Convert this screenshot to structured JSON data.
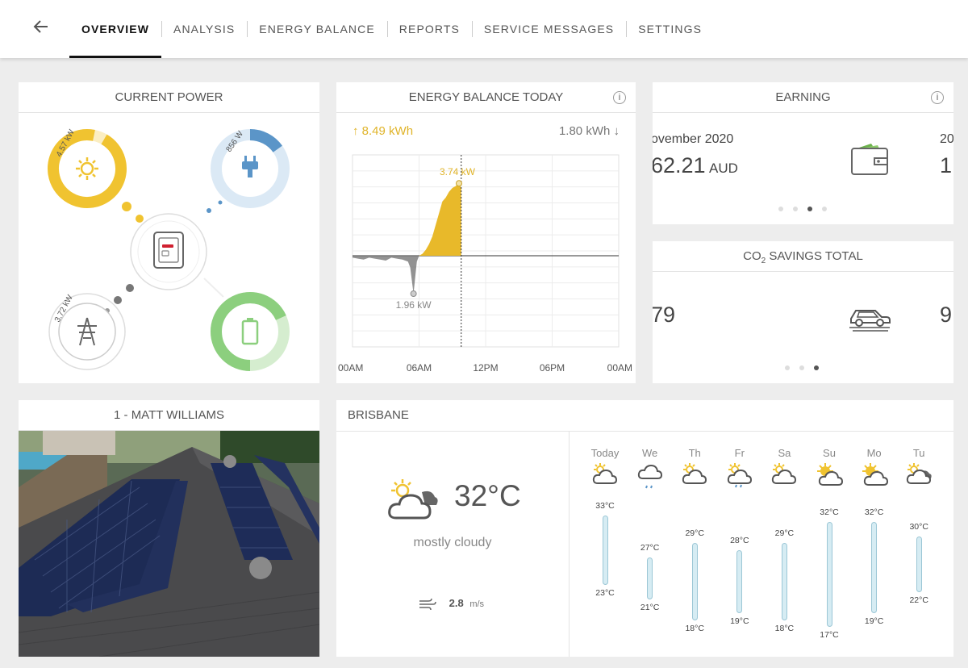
{
  "nav": {
    "back_label": "←",
    "tabs": [
      {
        "label": "OVERVIEW",
        "active": true
      },
      {
        "label": "ANALYSIS"
      },
      {
        "label": "ENERGY BALANCE"
      },
      {
        "label": "REPORTS"
      },
      {
        "label": "SERVICE MESSAGES"
      },
      {
        "label": "SETTINGS"
      }
    ]
  },
  "current_power": {
    "title": "CURRENT POWER",
    "solar": {
      "value": "4.57 kW",
      "icon": "sun-icon",
      "color": "#f0c330",
      "fraction": 0.95
    },
    "consumption": {
      "value": "856 W",
      "icon": "plug-icon",
      "color": "#5b95c8",
      "fraction": 0.2
    },
    "grid": {
      "value": "3.72 kW",
      "icon": "pylon-icon"
    },
    "battery": {
      "icon": "battery-icon",
      "color": "#8ccf7e"
    },
    "inverter": {
      "icon": "inverter-icon"
    }
  },
  "energy_balance": {
    "title": "ENERGY BALANCE TODAY",
    "produced": "8.49 kWh",
    "consumed": "1.80 kWh",
    "peak_label": "3.74 kW",
    "low_label": "1.96 kW",
    "x_ticks": [
      "00AM",
      "06AM",
      "12PM",
      "06PM",
      "00AM"
    ]
  },
  "chart_data": {
    "type": "area",
    "title": "ENERGY BALANCE TODAY",
    "x_ticks": [
      "00AM",
      "06AM",
      "12PM",
      "06PM",
      "00AM"
    ],
    "x_hours": [
      0,
      0.5,
      1,
      1.5,
      2,
      2.5,
      3,
      3.5,
      4,
      4.5,
      5,
      5.2,
      5.5,
      5.8,
      6,
      6.3,
      6.6,
      6.9,
      7.2,
      7.5,
      7.8,
      8.1,
      8.4,
      8.7,
      9,
      9.3,
      9.6,
      9.8
    ],
    "values_kw": [
      -0.1,
      -0.15,
      -0.2,
      -0.1,
      -0.15,
      -0.2,
      -0.25,
      -0.1,
      -0.15,
      -0.2,
      -0.3,
      -0.6,
      -1.96,
      -0.3,
      0.0,
      0.1,
      0.3,
      0.6,
      1.0,
      1.6,
      2.2,
      2.8,
      3.0,
      3.3,
      3.5,
      3.6,
      3.74,
      3.5
    ],
    "peak": {
      "x": 9.6,
      "y": 3.74,
      "label": "3.74 kW"
    },
    "low": {
      "x": 5.5,
      "y": -1.96,
      "label": "1.96 kW"
    },
    "now_hour": 9.8,
    "ylim": [
      -4,
      5
    ],
    "colors": {
      "positive": "#e8b92a",
      "negative": "#777777"
    }
  },
  "earning": {
    "title": "EARNING",
    "period": "ovember 2020",
    "value": "62.21",
    "currency": "AUD",
    "next_period": "20",
    "next_value": "1,",
    "icon": "wallet-icon"
  },
  "co2": {
    "title_prefix": "CO",
    "title_sub": "2",
    "title_suffix": " SAVINGS TOTAL",
    "value": "79",
    "next_value": "9",
    "icon": "car-icon"
  },
  "system": {
    "title": "1 - MATT WILLIAMS",
    "photo": "solar-roof-photo"
  },
  "weather": {
    "city": "BRISBANE",
    "temp": "32°C",
    "condition": "mostly cloudy",
    "wind": "2.8",
    "wind_unit": "m/s",
    "days": [
      {
        "name": "Today",
        "high": "33°C",
        "low": "23°C",
        "icon": "cloud-sun-icon"
      },
      {
        "name": "We",
        "high": "27°C",
        "low": "21°C",
        "icon": "rain-icon"
      },
      {
        "name": "Th",
        "high": "29°C",
        "low": "18°C",
        "icon": "cloud-sun-icon"
      },
      {
        "name": "Fr",
        "high": "28°C",
        "low": "19°C",
        "icon": "cloud-sun-rain-icon"
      },
      {
        "name": "Sa",
        "high": "29°C",
        "low": "18°C",
        "icon": "cloud-sun-icon"
      },
      {
        "name": "Su",
        "high": "32°C",
        "low": "17°C",
        "icon": "sun-cloud-icon"
      },
      {
        "name": "Mo",
        "high": "32°C",
        "low": "19°C",
        "icon": "sun-cloud-icon"
      },
      {
        "name": "Tu",
        "high": "30°C",
        "low": "22°C",
        "icon": "cloudy-icon"
      }
    ],
    "temp_values": {
      "high": [
        33,
        27,
        29,
        28,
        29,
        32,
        32,
        30
      ],
      "low": [
        23,
        21,
        18,
        19,
        18,
        17,
        19,
        22
      ]
    }
  }
}
